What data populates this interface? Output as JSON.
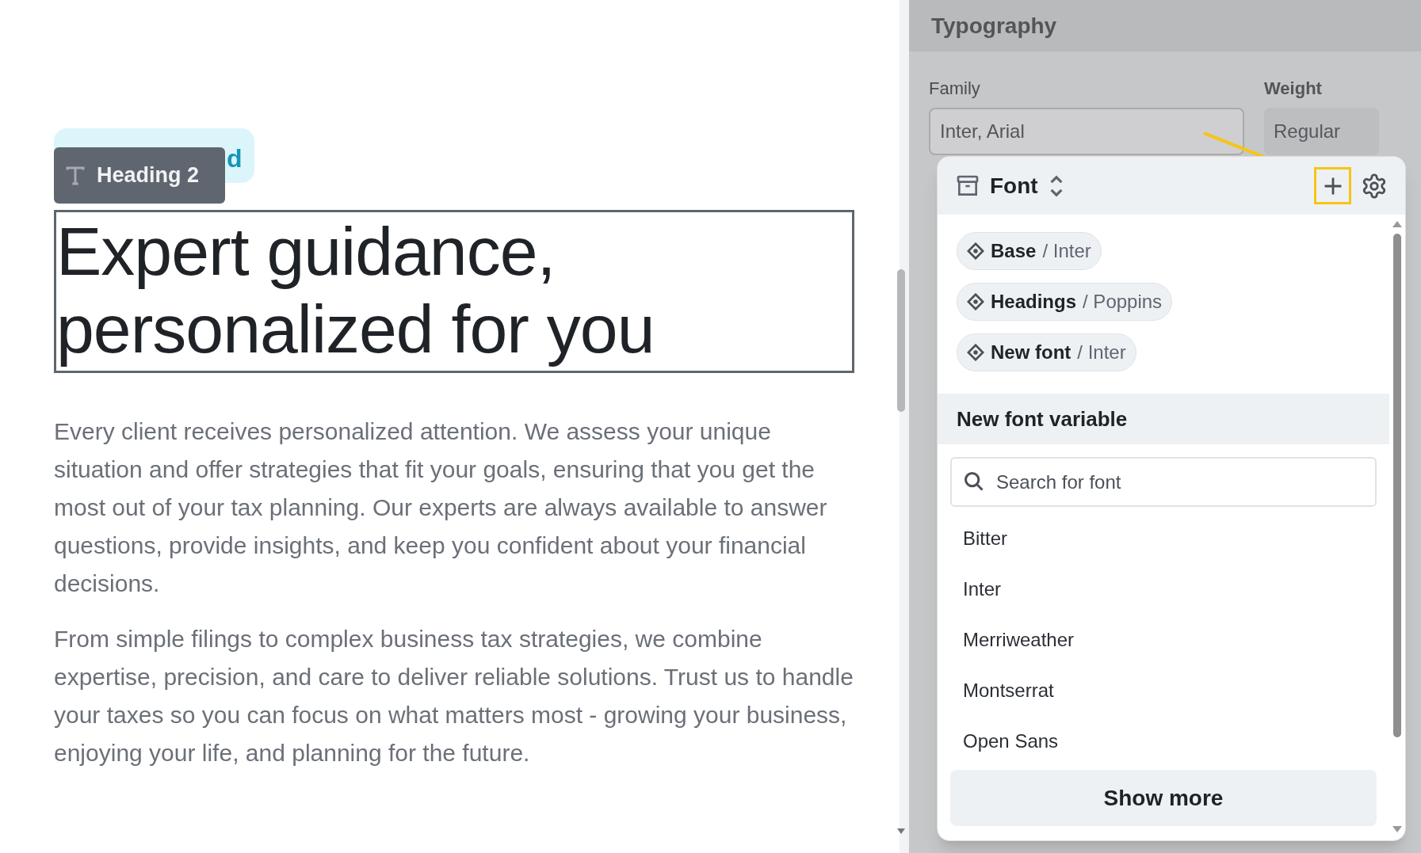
{
  "editor": {
    "tag": "d",
    "block_label": "Heading 2",
    "heading": "Expert guidance, personalized for you",
    "paragraphs": [
      "Every client receives personalized attention. We assess your unique situation and offer strategies that fit your goals, ensuring that you get the most out of your tax planning. Our experts are always available to answer questions, provide insights, and keep you confident about your financial decisions.",
      "From simple filings to complex business tax strategies, we combine expertise, precision, and care to deliver reliable solutions. Trust us to handle your taxes so you can focus on what matters most - growing your business, enjoying your life, and planning for the future."
    ]
  },
  "typography_panel": {
    "title": "Typography",
    "family_label": "Family",
    "family_value": "Inter, Arial",
    "weight_label": "Weight",
    "weight_value": "Regular"
  },
  "font_popover": {
    "title": "Font",
    "variables": [
      {
        "name": "Base",
        "font": "/ Inter"
      },
      {
        "name": "Headings",
        "font": "/ Poppins"
      },
      {
        "name": "New font",
        "font": "/ Inter"
      }
    ],
    "section_title": "New font variable",
    "search": {
      "placeholder": "Search for font"
    },
    "fonts": [
      "Bitter",
      "Inter",
      "Merriweather",
      "Montserrat",
      "Open Sans"
    ],
    "show_more": "Show more"
  }
}
